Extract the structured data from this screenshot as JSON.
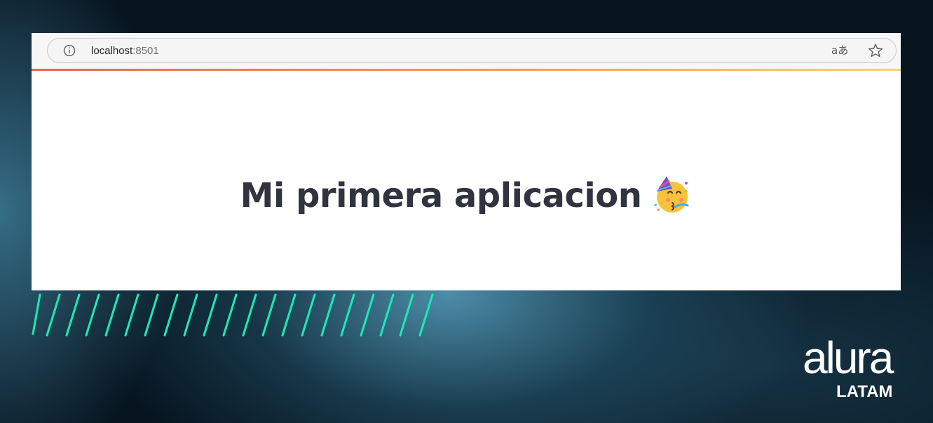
{
  "browser": {
    "address_bar": {
      "host": "localhost",
      "port": ":8501"
    },
    "icons": {
      "info": "info-icon",
      "translate": "translate-icon",
      "bookmark": "star-icon"
    },
    "translate_glyph": "aあ"
  },
  "app": {
    "title": "Mi primera aplicacion",
    "title_emoji": "partying-face-emoji",
    "text_color": "#31333f"
  },
  "branding": {
    "logo_word": "alura",
    "logo_sub": "LATAM",
    "accent_color": "#1de9b6"
  }
}
